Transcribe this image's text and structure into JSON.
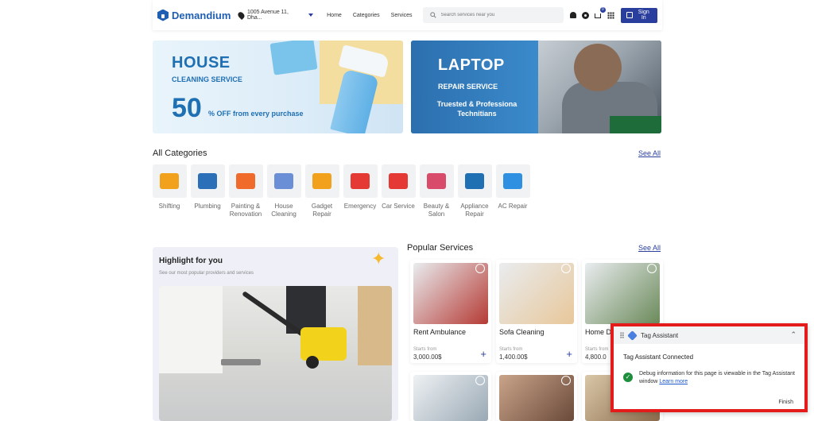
{
  "header": {
    "logo": "Demandium",
    "location": "1005 Avenue 11, Dha...",
    "nav": [
      "Home",
      "Categories",
      "Services"
    ],
    "search_placeholder": "Search services near you",
    "cart_count": "0",
    "signin": "Sign In"
  },
  "banner1": {
    "title": "HOUSE",
    "subtitle": "CLEANING SERVICE",
    "discount": "50",
    "off_text": "% OFF  from every purchase"
  },
  "banner2": {
    "title": "LAPTOP",
    "subtitle": "REPAIR SERVICE",
    "tagline": "Truested & Professiona Technitians"
  },
  "categories": {
    "title": "All Categories",
    "see_all": "See All",
    "items": [
      {
        "label": "Shifting",
        "color": "#f2a11d"
      },
      {
        "label": "Plumbing",
        "color": "#2a6fb8"
      },
      {
        "label": "Painting & Renovation",
        "color": "#f06a2b"
      },
      {
        "label": "House Cleaning",
        "color": "#6b8fd6"
      },
      {
        "label": "Gadget Repair",
        "color": "#f2a11d"
      },
      {
        "label": "Emergency",
        "color": "#e53935"
      },
      {
        "label": "Car Service",
        "color": "#e53935"
      },
      {
        "label": "Beauty & Salon",
        "color": "#d94b6a"
      },
      {
        "label": "Appliance Repair",
        "color": "#1f6fb3"
      },
      {
        "label": "AC Repair",
        "color": "#2f8fe0"
      }
    ]
  },
  "highlight": {
    "title": "Highlight for you",
    "subtitle": "See our most popular providers and services"
  },
  "popular": {
    "title": "Popular Services",
    "see_all": "See All",
    "cards": [
      {
        "name": "Rent Ambulance",
        "starts": "Starts from",
        "price": "3,000.00$",
        "color": "#b53a34"
      },
      {
        "name": "Sofa Cleaning",
        "starts": "Starts from",
        "price": "1,400.00$",
        "color": "#e8c79a"
      },
      {
        "name": "Home D",
        "starts": "Starts from",
        "price": "4,800.0",
        "color": "#6b8a5a"
      }
    ]
  },
  "tag_assistant": {
    "title": "Tag Assistant",
    "connected": "Tag Assistant Connected",
    "message": "Debug information for this page is viewable in the Tag Assistant window",
    "learn_more": "Learn more",
    "finish": "Finish"
  }
}
